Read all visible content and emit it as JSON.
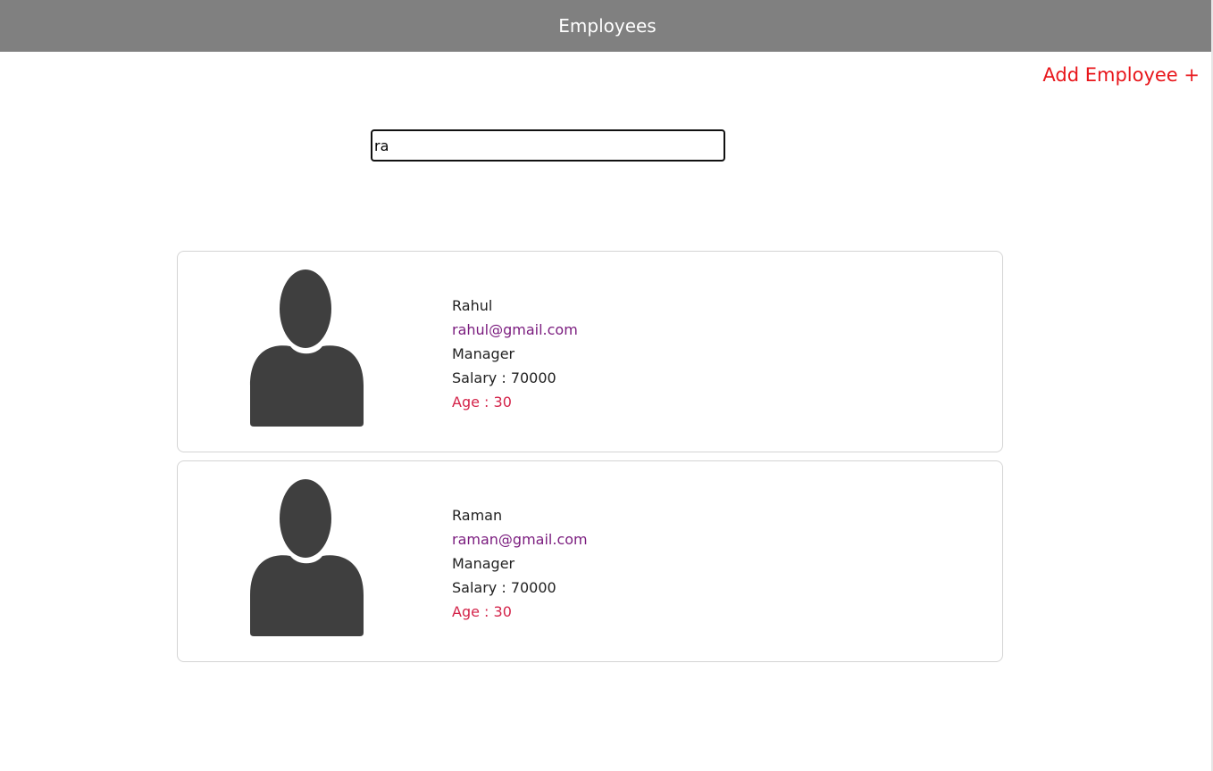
{
  "header": {
    "title": "Employees"
  },
  "actions": {
    "add_employee_label": "Add Employee +"
  },
  "search": {
    "value": "ra",
    "placeholder": ""
  },
  "employees": [
    {
      "name": "Rahul",
      "email": "rahul@gmail.com",
      "role": "Manager",
      "salary": "Salary : 70000",
      "age": "Age : 30",
      "avatar_icon": "person-avatar-icon"
    },
    {
      "name": "Raman",
      "email": "raman@gmail.com",
      "role": "Manager",
      "salary": "Salary : 70000",
      "age": "Age : 30",
      "avatar_icon": "person-avatar-icon"
    }
  ],
  "colors": {
    "header_bg": "#808080",
    "add_link": "#e8161b",
    "email": "#7a1b7e",
    "age": "#d4244a"
  }
}
